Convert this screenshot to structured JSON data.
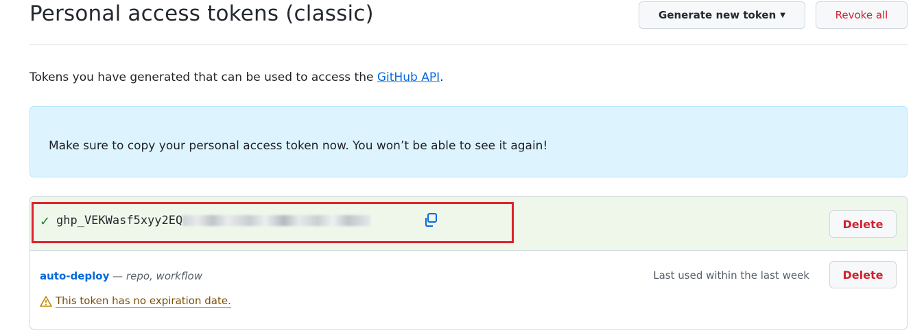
{
  "header": {
    "title": "Personal access tokens (classic)",
    "generate_label": "Generate new token",
    "revoke_label": "Revoke all"
  },
  "intro": {
    "text": "Tokens you have generated that can be used to access the ",
    "link": "GitHub API",
    "suffix": "."
  },
  "flash": {
    "message": "Make sure to copy your personal access token now. You won’t be able to see it again!"
  },
  "new_token": {
    "value_visible": "ghp_VEKWasf5xyy2EQ",
    "delete_label": "Delete"
  },
  "tokens": [
    {
      "name": "auto-deploy",
      "dash": " — ",
      "scopes": "repo, workflow",
      "last_used": "Last used within the last week",
      "warning": "This token has no expiration date.",
      "delete_label": "Delete"
    }
  ],
  "colors": {
    "accent": "#0969da",
    "danger": "#cf222e",
    "success": "#1a7f37",
    "highlight_border": "#e0202a",
    "flash_bg": "#ddf4ff"
  },
  "icons": [
    "check-icon",
    "copy-icon",
    "caret-down-icon",
    "alert-icon"
  ]
}
